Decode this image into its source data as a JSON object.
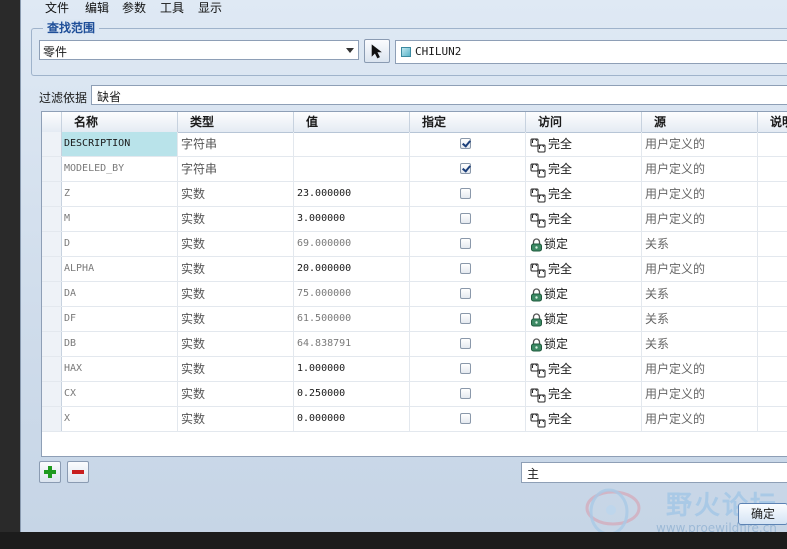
{
  "menu": [
    "文件",
    "编辑",
    "参数",
    "工具",
    "显示"
  ],
  "search_scope": {
    "title": "查找范围",
    "type_value": "零件",
    "model_name": "CHILUN2"
  },
  "filter": {
    "label": "过滤依据",
    "value": "缺省"
  },
  "columns": [
    "名称",
    "类型",
    "值",
    "指定",
    "访问",
    "源",
    "说明"
  ],
  "rows": [
    {
      "name": "DESCRIPTION",
      "type": "字符串",
      "value": "",
      "designated": true,
      "access": "完全",
      "access_icon": "full-access-icon",
      "source": "用户定义的",
      "selected": true,
      "value_dim": false
    },
    {
      "name": "MODELED_BY",
      "type": "字符串",
      "value": "",
      "designated": true,
      "access": "完全",
      "access_icon": "full-access-icon",
      "source": "用户定义的",
      "selected": false,
      "value_dim": false
    },
    {
      "name": "Z",
      "type": "实数",
      "value": "23.000000",
      "designated": false,
      "access": "完全",
      "access_icon": "full-access-icon",
      "source": "用户定义的",
      "selected": false,
      "value_dim": false
    },
    {
      "name": "M",
      "type": "实数",
      "value": "3.000000",
      "designated": false,
      "access": "完全",
      "access_icon": "full-access-icon",
      "source": "用户定义的",
      "selected": false,
      "value_dim": false
    },
    {
      "name": "D",
      "type": "实数",
      "value": "69.000000",
      "designated": false,
      "access": "锁定",
      "access_icon": "lock-icon",
      "source": "关系",
      "selected": false,
      "value_dim": true
    },
    {
      "name": "ALPHA",
      "type": "实数",
      "value": "20.000000",
      "designated": false,
      "access": "完全",
      "access_icon": "full-access-icon",
      "source": "用户定义的",
      "selected": false,
      "value_dim": false
    },
    {
      "name": "DA",
      "type": "实数",
      "value": "75.000000",
      "designated": false,
      "access": "锁定",
      "access_icon": "lock-icon",
      "source": "关系",
      "selected": false,
      "value_dim": true
    },
    {
      "name": "DF",
      "type": "实数",
      "value": "61.500000",
      "designated": false,
      "access": "锁定",
      "access_icon": "lock-icon",
      "source": "关系",
      "selected": false,
      "value_dim": true
    },
    {
      "name": "DB",
      "type": "实数",
      "value": "64.838791",
      "designated": false,
      "access": "锁定",
      "access_icon": "lock-icon",
      "source": "关系",
      "selected": false,
      "value_dim": true
    },
    {
      "name": "HAX",
      "type": "实数",
      "value": "1.000000",
      "designated": false,
      "access": "完全",
      "access_icon": "full-access-icon",
      "source": "用户定义的",
      "selected": false,
      "value_dim": false
    },
    {
      "name": "CX",
      "type": "实数",
      "value": "0.250000",
      "designated": false,
      "access": "完全",
      "access_icon": "full-access-icon",
      "source": "用户定义的",
      "selected": false,
      "value_dim": false
    },
    {
      "name": "X",
      "type": "实数",
      "value": "0.000000",
      "designated": false,
      "access": "完全",
      "access_icon": "full-access-icon",
      "source": "用户定义的",
      "selected": false,
      "value_dim": false
    }
  ],
  "bottom": {
    "field_value": "主",
    "ok_label": "确定"
  },
  "watermark": {
    "text": "野火论坛",
    "url": "www.proewildfire.cn"
  },
  "colors": {
    "selected_cell": "#b9e3ea",
    "group_title": "#1f4f99",
    "add": "#1e9a1e",
    "remove": "#c81e1e"
  }
}
